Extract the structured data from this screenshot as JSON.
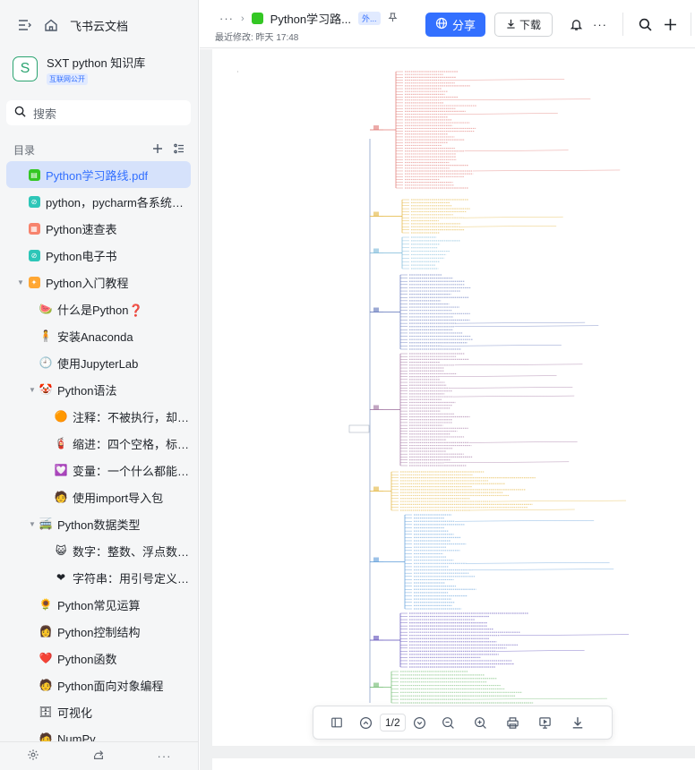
{
  "app": {
    "brand": "飞书云文档"
  },
  "kb": {
    "name": "SXT python 知识库",
    "badge": "互联网公开"
  },
  "search": {
    "placeholder": "搜索"
  },
  "toc": {
    "title": "目录"
  },
  "tree": [
    {
      "label": "Python学习路线.pdf",
      "depth": 0,
      "icon": "pdf",
      "color": "#34c724",
      "active": true
    },
    {
      "label": "python，pycharm各系统下载...",
      "depth": 0,
      "icon": "link",
      "color": "#2dc6b8"
    },
    {
      "label": "Python速查表",
      "depth": 0,
      "icon": "sheet",
      "color": "#f7836d"
    },
    {
      "label": "Python电子书",
      "depth": 0,
      "icon": "link",
      "color": "#2dc6b8"
    },
    {
      "label": "Python入门教程",
      "depth": 0,
      "icon": "star",
      "color": "#ffa734",
      "caret": true
    },
    {
      "label": "什么是Python❓",
      "depth": 1,
      "emoji": "🍉"
    },
    {
      "label": "安装Anaconda",
      "depth": 1,
      "emoji": "🧍"
    },
    {
      "label": "使用JupyterLab",
      "depth": 1,
      "emoji": "🕘"
    },
    {
      "label": "Python语法",
      "depth": 1,
      "emoji": "🤡",
      "caret": true
    },
    {
      "label": "注释：不被执行，却很...",
      "depth": 2,
      "emoji": "🟠"
    },
    {
      "label": "缩进：四个空格，标识...",
      "depth": 2,
      "emoji": "🧯"
    },
    {
      "label": "变量：一个什么都能装...",
      "depth": 2,
      "emoji": "💟"
    },
    {
      "label": "使用import导入包",
      "depth": 2,
      "emoji": "🧑"
    },
    {
      "label": "Python数据类型",
      "depth": 1,
      "emoji": "🚎",
      "caret": true
    },
    {
      "label": "数字：整数、浮点数、...",
      "depth": 2,
      "emoji": "😺"
    },
    {
      "label": "字符串：用引号定义的...",
      "depth": 2,
      "emoji": "❤"
    },
    {
      "label": "Python常见运算",
      "depth": 1,
      "emoji": "🌻"
    },
    {
      "label": "Python控制结构",
      "depth": 1,
      "emoji": "👩"
    },
    {
      "label": "Python函数",
      "depth": 1,
      "emoji": "❤️"
    },
    {
      "label": "Python面向对象编程",
      "depth": 1,
      "emoji": "🧑"
    },
    {
      "label": "可视化",
      "depth": 1,
      "emoji": "🗄"
    },
    {
      "label": "NumPy",
      "depth": 1,
      "emoji": "🧑"
    }
  ],
  "header": {
    "title": "Python学习路...",
    "tag": "外...",
    "modified": "最近修改: 昨天 17:48",
    "share_label": "分享",
    "download_label": "下载"
  },
  "pdf": {
    "page_indicator": "1/2"
  }
}
